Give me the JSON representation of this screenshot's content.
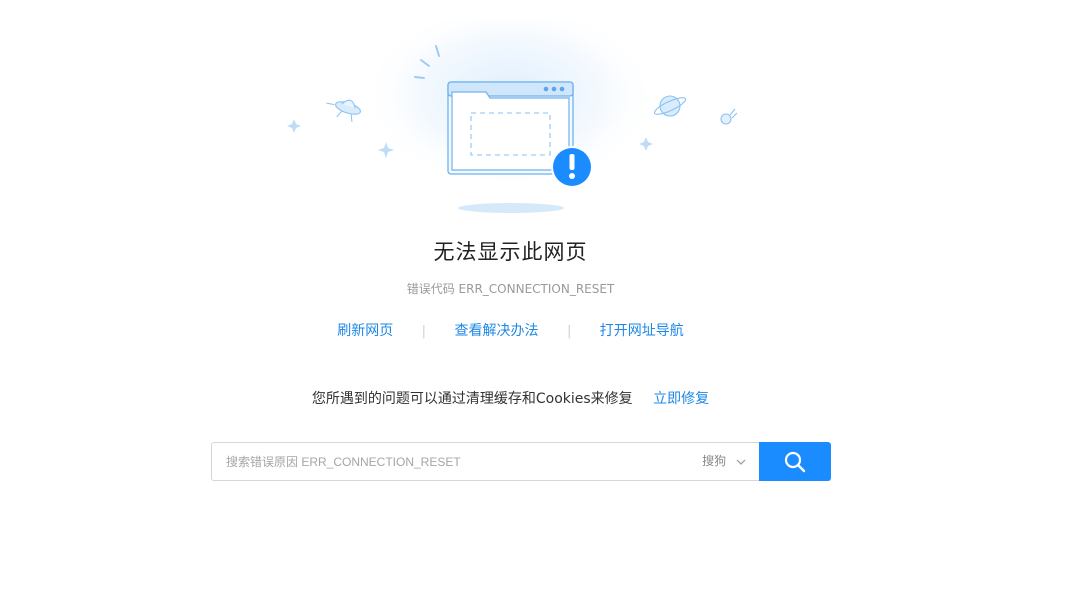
{
  "page": {
    "title": "无法显示此网页",
    "error_code_text": "错误代码 ERR_CONNECTION_RESET"
  },
  "links": {
    "refresh": "刷新网页",
    "solutions": "查看解决办法",
    "navigation": "打开网址导航",
    "separator": "|"
  },
  "fix": {
    "message": "您所遇到的问题可以通过清理缓存和Cookies来修复",
    "action": "立即修复"
  },
  "search": {
    "placeholder": "搜索错误原因 ERR_CONNECTION_RESET",
    "value": "",
    "engine": "搜狗",
    "button_icon": "search-icon"
  },
  "colors": {
    "accent": "#1a8cff",
    "link": "#1e88e5",
    "alert": "#1a8cff"
  },
  "icons": {
    "illustration": "error-window-illustration",
    "alert": "exclamation-icon",
    "ufo": "ufo-icon",
    "planet": "planet-icon",
    "comet": "comet-icon"
  }
}
